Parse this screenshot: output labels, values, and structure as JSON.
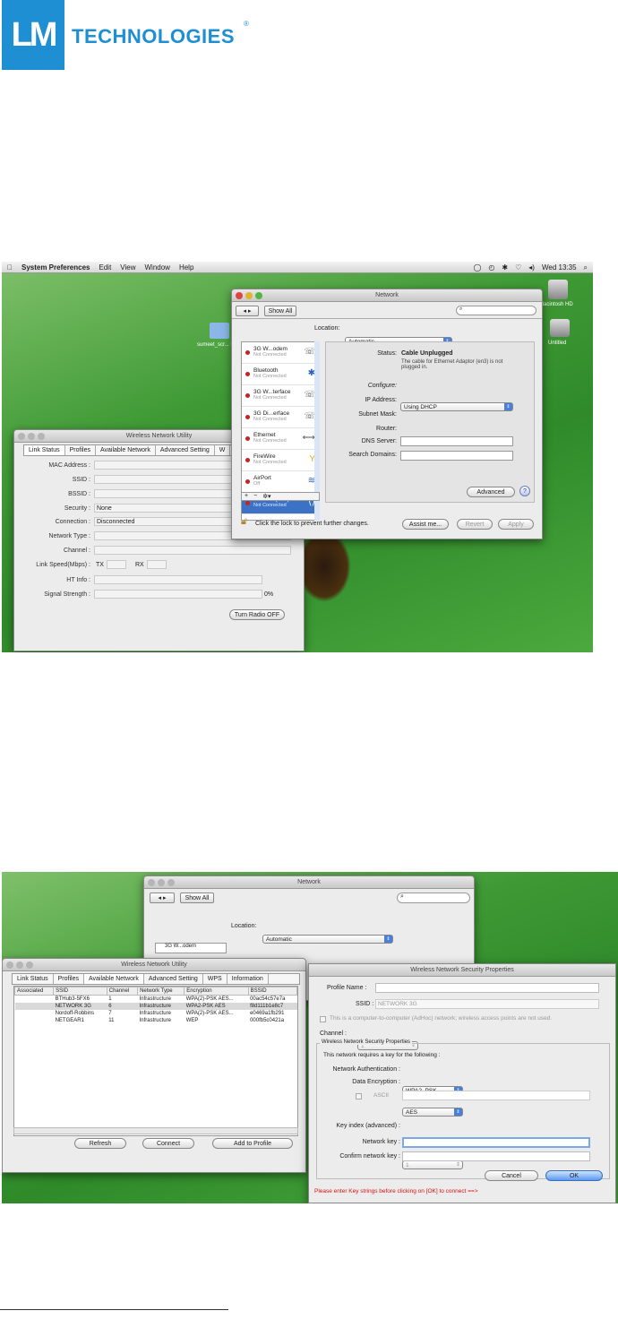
{
  "brand": {
    "logo_letters": "LM",
    "name": "TECHNOLOGIES",
    "reg": "®"
  },
  "shot1": {
    "menubar": {
      "apple": "",
      "app": "System Preferences",
      "items": [
        "Edit",
        "View",
        "Window",
        "Help"
      ],
      "clock": "Wed 13:35"
    },
    "desktop": {
      "hd_label": "Macintosh HD",
      "untitled_label": "Untitled",
      "folder_label": "sumeet_scr... LMU..."
    },
    "network_window": {
      "title": "Network",
      "show_all": "Show All",
      "search_placeholder": "",
      "location_label": "Location:",
      "location_value": "Automatic",
      "services": [
        {
          "name": "3G W...odem",
          "status": "Not Connected"
        },
        {
          "name": "Bluetooth",
          "status": "Not Connected"
        },
        {
          "name": "3G W...terface",
          "status": "Not Connected"
        },
        {
          "name": "3G Di...erface",
          "status": "Not Connected"
        },
        {
          "name": "Ethernet",
          "status": "Not Connected"
        },
        {
          "name": "FireWire",
          "status": "Not Connected"
        },
        {
          "name": "AirPort",
          "status": "Off"
        },
        {
          "name": "Ether...r (en3)",
          "status": "Not Connected"
        }
      ],
      "status_label": "Status:",
      "status_value": "Cable Unplugged",
      "status_desc": "The cable for Ethernet Adaptor (en3) is not plugged in.",
      "configure_label": "Configure:",
      "configure_value": "Using DHCP",
      "ip_label": "IP Address:",
      "subnet_label": "Subnet Mask:",
      "router_label": "Router:",
      "dns_label": "DNS Server:",
      "search_domains_label": "Search Domains:",
      "advanced": "Advanced",
      "help": "?",
      "lock_text": "Click the lock to prevent further changes.",
      "assist": "Assist me...",
      "revert": "Revert",
      "apply": "Apply",
      "list_add": "+",
      "list_remove": "−",
      "list_gear": "✲▾"
    },
    "wnu_window": {
      "title": "Wireless Network Utility",
      "tabs": [
        "Link Status",
        "Profiles",
        "Available Network",
        "Advanced Setting",
        "W"
      ],
      "fields": {
        "mac": "MAC Address :",
        "ssid": "SSID :",
        "bssid": "BSSID :",
        "security": "Security :",
        "security_value": "None",
        "connection": "Connection :",
        "connection_value": "Disconnected",
        "network_type": "Network Type :",
        "channel": "Channel :",
        "link_speed": "Link Speed(Mbps) :",
        "tx": "TX",
        "rx": "RX",
        "ht_info": "HT Info :",
        "signal": "Signal Strength :",
        "signal_value": "0%"
      },
      "radio_button": "Turn Radio OFF"
    }
  },
  "shot2": {
    "network_window": {
      "title": "Network",
      "show_all": "Show All",
      "location_label": "Location:",
      "location_value": "Automatic",
      "partial_item": "3G W...odem"
    },
    "wnu_window": {
      "title": "Wireless Network Utility",
      "tabs": [
        "Link Status",
        "Profiles",
        "Available Network",
        "Advanced Setting",
        "WPS",
        "Information"
      ],
      "columns": [
        "Associated",
        "SSID",
        "Channel",
        "Network Type",
        "Encryption",
        "BSSID"
      ],
      "rows": [
        [
          "",
          "BTHub3-5FX6",
          "1",
          "Infrastructure",
          "WPA(2)-PSK AES...",
          "00ac54c57e7a"
        ],
        [
          "",
          "NETWORK 3G",
          "6",
          "Infrastructure",
          "WPA2-PSK AES",
          "f8d111b1e8c7"
        ],
        [
          "",
          "Nordoff-Robbins",
          "7",
          "Infrastructure",
          "WPA(2)-PSK AES...",
          "e0469a1fb291"
        ],
        [
          "",
          "NETGEAR1",
          "11",
          "Infrastructure",
          "WEP",
          "000fb5c0421a"
        ]
      ],
      "refresh": "Refresh",
      "connect": "Connect",
      "add_profile": "Add to Profile"
    },
    "security_window": {
      "title": "Wireless Network Security Properties",
      "profile_label": "Profile Name :",
      "ssid_label": "SSID :",
      "ssid_value": "NETWORK 3G",
      "adhoc_text": "This is a computer-to-computer (AdHoc) network; wireless access points are not used.",
      "channel_label": "Channel :",
      "channel_value": "1",
      "group_title": "Wireless Network Security Properties",
      "requires_text": "This network requires a key for the following :",
      "auth_label": "Network Authentication :",
      "auth_value": "WPA2_PSK",
      "enc_label": "Data Encryption :",
      "enc_value": "AES",
      "ascii_label": "ASCII",
      "keyidx_label": "Key index (advanced) :",
      "keyidx_value": "1",
      "netkey_label": "Network key :",
      "confirm_label": "Confirm network key :",
      "cancel": "Cancel",
      "ok": "OK",
      "warning": "Please enter Key strings before clicking on [OK] to connect ==>"
    }
  }
}
